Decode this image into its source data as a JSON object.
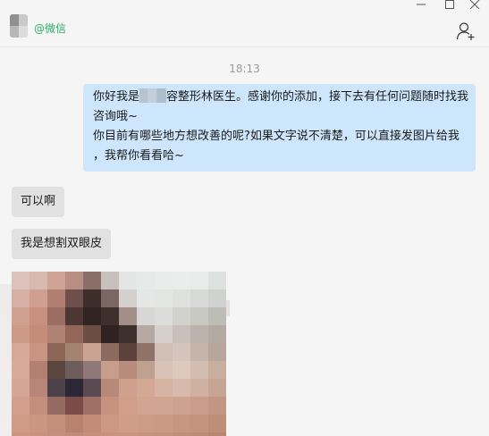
{
  "window": {
    "contact_source": "@微信",
    "controls": [
      "minimize",
      "maximize",
      "close"
    ]
  },
  "header": {
    "add_contact_icon": "add-person-icon"
  },
  "chat": {
    "timestamp": "18:13",
    "outgoing": {
      "lines": [
        "你好我是",
        "容整形林医生。感谢你的添加，接下去有任何问题随时找我",
        "咨询哦~",
        "你目前有哪些地方想改善的呢?如果文字说不清楚，可以直接发图片给我",
        "，我帮你看看哈~"
      ]
    },
    "incoming": [
      {
        "text": "可以啊"
      },
      {
        "text": "我是想割双眼皮"
      }
    ],
    "image_message": {
      "icon": "photo-thumbnail"
    }
  },
  "colors": {
    "accent_green": "#2aae67",
    "outgoing_bubble": "#cde6fb",
    "incoming_bubble": "#e1e1e1",
    "background": "#f5f5f5"
  }
}
